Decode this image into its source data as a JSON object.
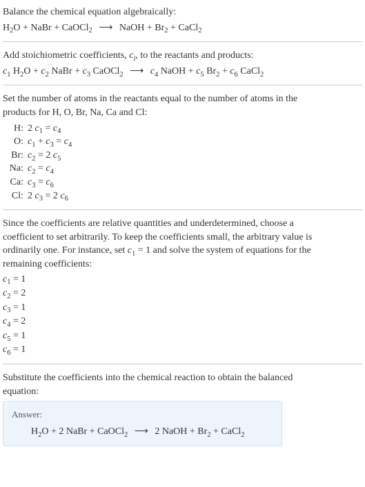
{
  "intro": {
    "line1": "Balance the chemical equation algebraically:"
  },
  "reaction_unbalanced": {
    "lhs": [
      "H",
      "2",
      "O + NaBr + CaOCl",
      "2"
    ],
    "arrow": "⟶",
    "rhs": [
      "NaOH + Br",
      "2",
      " + CaCl",
      "2"
    ]
  },
  "stoich_intro": {
    "text_a": "Add stoichiometric coefficients, ",
    "ci": "c",
    "ci_sub": "i",
    "text_b": ", to the reactants and products:"
  },
  "reaction_coeffs": {
    "parts": [
      {
        "c": "c",
        "sub": "1",
        "sp": " H",
        "sub2": "2",
        "tail": "O + "
      },
      {
        "c": "c",
        "sub": "2",
        "sp": " NaBr + "
      },
      {
        "c": "c",
        "sub": "3",
        "sp": " CaOCl",
        "sub2": "2"
      }
    ],
    "arrow": "⟶",
    "parts_rhs": [
      {
        "c": "c",
        "sub": "4",
        "sp": " NaOH + "
      },
      {
        "c": "c",
        "sub": "5",
        "sp": " Br",
        "sub2": "2",
        "tail": " + "
      },
      {
        "c": "c",
        "sub": "6",
        "sp": " CaCl",
        "sub2": "2"
      }
    ]
  },
  "atoms_intro_a": "Set the number of atoms in the reactants equal to the number of atoms in the",
  "atoms_intro_b": "products for H, O, Br, Na, Ca and Cl:",
  "atoms": [
    {
      "el": "H:",
      "lhs_a": "2 ",
      "c1": "c",
      "s1": "1",
      "mid": " = ",
      "c2": "c",
      "s2": "4"
    },
    {
      "el": "O:",
      "c1": "c",
      "s1": "1",
      "mid1": " + ",
      "c2": "c",
      "s2": "3",
      "mid2": " = ",
      "c3": "c",
      "s3": "4"
    },
    {
      "el": "Br:",
      "c1": "c",
      "s1": "2",
      "mid": " = 2 ",
      "c2": "c",
      "s2": "5"
    },
    {
      "el": "Na:",
      "c1": "c",
      "s1": "2",
      "mid": " = ",
      "c2": "c",
      "s2": "4"
    },
    {
      "el": "Ca:",
      "c1": "c",
      "s1": "3",
      "mid": " = ",
      "c2": "c",
      "s2": "6"
    },
    {
      "el": "Cl:",
      "lhs_a": "2 ",
      "c1": "c",
      "s1": "3",
      "mid": " = 2 ",
      "c2": "c",
      "s2": "6"
    }
  ],
  "underdetermined_a": "Since the coefficients are relative quantities and underdetermined, choose a",
  "underdetermined_b": "coefficient to set arbitrarily. To keep the coefficients small, the arbitrary value is",
  "underdetermined_c_a": "ordinarily one. For instance, set ",
  "underdetermined_c_c": "c",
  "underdetermined_c_s": "1",
  "underdetermined_c_b": " = 1 and solve the system of equations for the",
  "underdetermined_d": "remaining coefficients:",
  "coefficients": [
    {
      "c": "c",
      "s": "1",
      "v": " = 1"
    },
    {
      "c": "c",
      "s": "2",
      "v": " = 2"
    },
    {
      "c": "c",
      "s": "3",
      "v": " = 1"
    },
    {
      "c": "c",
      "s": "4",
      "v": " = 2"
    },
    {
      "c": "c",
      "s": "5",
      "v": " = 1"
    },
    {
      "c": "c",
      "s": "6",
      "v": " = 1"
    }
  ],
  "substitute_a": "Substitute the coefficients into the chemical reaction to obtain the balanced",
  "substitute_b": "equation:",
  "answer": {
    "label": "Answer:",
    "lhs": [
      "H",
      "2",
      "O + 2 NaBr + CaOCl",
      "2"
    ],
    "arrow": "⟶",
    "rhs": [
      "2 NaOH + Br",
      "2",
      " + CaCl",
      "2"
    ]
  }
}
